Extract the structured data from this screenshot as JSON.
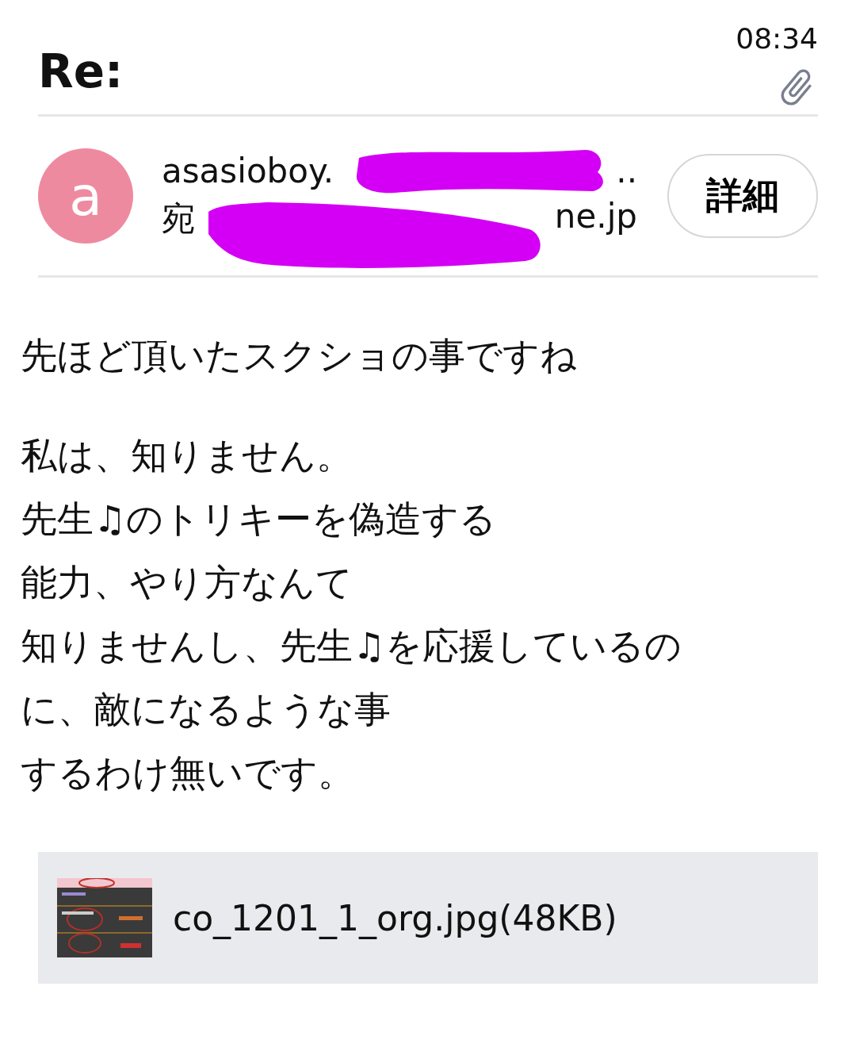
{
  "header": {
    "subject": "Re:",
    "time": "08:34",
    "has_attachment": true
  },
  "sender": {
    "avatar_letter": "a",
    "name_start": "asasioboy.",
    "name_end": "..",
    "to_start": "宛",
    "to_end": "ne.jp",
    "details_button": "詳細"
  },
  "body": {
    "paragraphs": [
      [
        "先ほど頂いたスクショの事ですね"
      ],
      [
        "私は、知りません。",
        "先生♫のトリキーを偽造する",
        "能力、やり方なんて",
        "知りませんし、先生♫を応援しているの",
        "に、敵になるような事",
        "するわけ無いです。"
      ]
    ]
  },
  "attachment": {
    "kind": "picture",
    "filename": "co_1201_1_org.jpg(48KB)"
  }
}
